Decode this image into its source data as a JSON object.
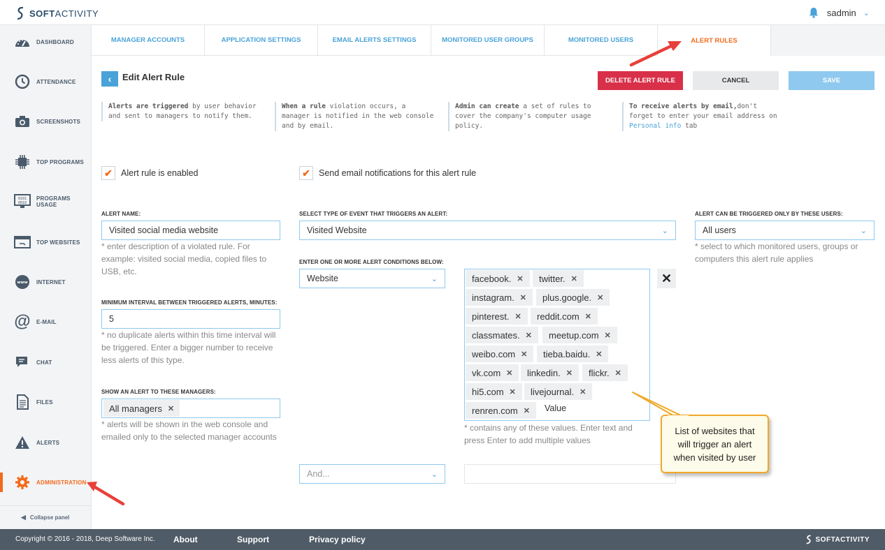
{
  "app": {
    "logo_bold": "SOFT",
    "logo_rest": "ACTIVITY",
    "username": "sadmin"
  },
  "sidebar": {
    "items": [
      {
        "label": "DASHBOARD",
        "icon": "dashboard-icon"
      },
      {
        "label": "ATTENDANCE",
        "icon": "attendance-icon"
      },
      {
        "label": "SCREENSHOTS",
        "icon": "camera-icon"
      },
      {
        "label": "TOP PROGRAMS",
        "icon": "chip-icon"
      },
      {
        "label": "PROGRAMS USAGE",
        "icon": "binary-monitor-icon"
      },
      {
        "label": "TOP WEBSITES",
        "icon": "browser-window-icon"
      },
      {
        "label": "INTERNET",
        "icon": "www-globe-icon"
      },
      {
        "label": "E-MAIL",
        "icon": "at-sign-icon"
      },
      {
        "label": "CHAT",
        "icon": "chat-bubble-icon"
      },
      {
        "label": "FILES",
        "icon": "document-icon"
      },
      {
        "label": "ALERTS",
        "icon": "warning-icon"
      },
      {
        "label": "ADMINISTRATION",
        "icon": "gear-icon",
        "active": true
      }
    ],
    "collapse_label": "Collapse panel"
  },
  "tabs": [
    {
      "label": "MANAGER ACCOUNTS"
    },
    {
      "label": "APPLICATION SETTINGS"
    },
    {
      "label": "EMAIL ALERTS SETTINGS"
    },
    {
      "label": "MONITORED USER GROUPS"
    },
    {
      "label": "MONITORED USERS"
    },
    {
      "label": "ALERT RULES",
      "active": true
    }
  ],
  "header": {
    "title": "Edit Alert Rule",
    "delete_label": "DELETE ALERT RULE",
    "cancel_label": "CANCEL",
    "save_label": "SAVE"
  },
  "info": [
    {
      "bold": "Alerts are triggered",
      "text": " by user behavior and sent to managers to notify them."
    },
    {
      "bold": "When a rule",
      "text": " violation occurs, a manager is notified in the web console and by email."
    },
    {
      "bold": "Admin can create",
      "text": " a set of rules to cover the company's computer usage policy."
    },
    {
      "bold": "To receive alerts by email,",
      "text": "don't forget to enter your email address on ",
      "link": "Personal info",
      "after": " tab"
    }
  ],
  "checks": {
    "enabled_label": "Alert rule is enabled",
    "email_label": "Send email notifications for this alert rule"
  },
  "form": {
    "alert_name_label": "ALERT NAME:",
    "alert_name_value": "Visited social media website",
    "alert_name_help": "* enter description of a violated rule. For example: visited social media, copied files to USB, etc.",
    "interval_label": "MINIMUM INTERVAL BETWEEN TRIGGERED ALERTS, MINUTES:",
    "interval_value": "5",
    "interval_help": "* no duplicate alerts within this time interval will be triggered. Enter a bigger number to receive less alerts of this type.",
    "managers_label": "SHOW AN ALERT TO THESE MANAGERS:",
    "managers_chip": "All managers",
    "managers_help": "* alerts will be shown in the web console and emailed only to the selected manager accounts",
    "event_type_label": "SELECT TYPE OF EVENT THAT TRIGGERS AN ALERT:",
    "event_type_value": "Visited Website",
    "conditions_label": "ENTER ONE OR MORE ALERT CONDITIONS BELOW:",
    "condition_field": "Website",
    "conditions_help": "* contains any of these values. Enter text and press Enter to add multiple values",
    "and_placeholder": "And...",
    "value_placeholder": "Value",
    "users_label": "ALERT CAN BE TRIGGERED ONLY BY THESE USERS:",
    "users_value": "All users",
    "users_help": "* select to which monitored users, groups or computers this alert rule applies"
  },
  "tags": [
    [
      "facebook.",
      "twitter."
    ],
    [
      "instagram.",
      "plus.google."
    ],
    [
      "pinterest.",
      "reddit.com"
    ],
    [
      "classmates.",
      "meetup.com"
    ],
    [
      "weibo.com",
      "tieba.baidu."
    ],
    [
      "vk.com",
      "linkedin.",
      "flickr."
    ],
    [
      "hi5.com",
      "livejournal."
    ],
    [
      "renren.com"
    ]
  ],
  "callout": {
    "text": "List of websites that will trigger an alert when visited by user"
  },
  "footer": {
    "copyright": "Copyright © 2016 - 2018, Deep Software Inc.",
    "about": "About",
    "support": "Support",
    "privacy": "Privacy policy",
    "brand": "SOFTACTIVITY"
  },
  "colors": {
    "accent": "#4aa3d8",
    "active": "#f26b1d",
    "delete": "#d9304a",
    "footer": "#4f5b66",
    "arrow": "#e8403a",
    "callout_border": "#f0a82a"
  }
}
